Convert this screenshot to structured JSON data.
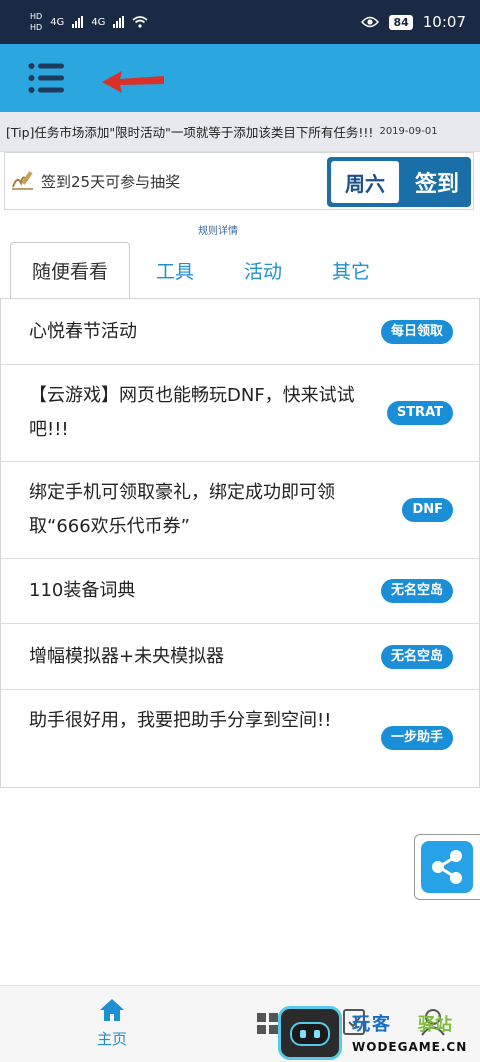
{
  "status_bar": {
    "hd1": "HD",
    "hd2": "HD",
    "net1": "4G",
    "net2": "4G",
    "battery": "84",
    "time": "10:07"
  },
  "tip": {
    "text": "[Tip]任务市场添加\"限时活动\"一项就等于添加该类目下所有任务!!!",
    "date": "2019-09-01"
  },
  "signin": {
    "text": "签到25天可参与抽奖",
    "day": "周六",
    "button": "签到",
    "rule_link": "规则详情"
  },
  "tabs": [
    {
      "label": "随便看看",
      "active": true
    },
    {
      "label": "工具",
      "active": false
    },
    {
      "label": "活动",
      "active": false
    },
    {
      "label": "其它",
      "active": false
    }
  ],
  "list": [
    {
      "text": "心悦春节活动",
      "badge": "每日领取"
    },
    {
      "text": "【云游戏】网页也能畅玩DNF，快来试试吧!!!",
      "badge": "STRAT"
    },
    {
      "text": "绑定手机可领取豪礼，绑定成功即可领取“666欢乐代币券”",
      "badge": "DNF"
    },
    {
      "text": "110装备词典",
      "badge": "无名空岛"
    },
    {
      "text": "增幅模拟器+未央模拟器",
      "badge": "无名空岛"
    },
    {
      "text": "助手很好用，我要把助手分享到空间!!",
      "badge": "一步助手"
    }
  ],
  "bottom_nav": {
    "home_label": "主页"
  },
  "watermark": {
    "title_a": "玩客",
    "title_b": "驿站",
    "url": "WODEGAME.CN"
  },
  "colors": {
    "accent": "#2ba6df",
    "status_bar": "#1b2a44",
    "badge": "#1a8fd8",
    "arrow": "#d9302a"
  }
}
